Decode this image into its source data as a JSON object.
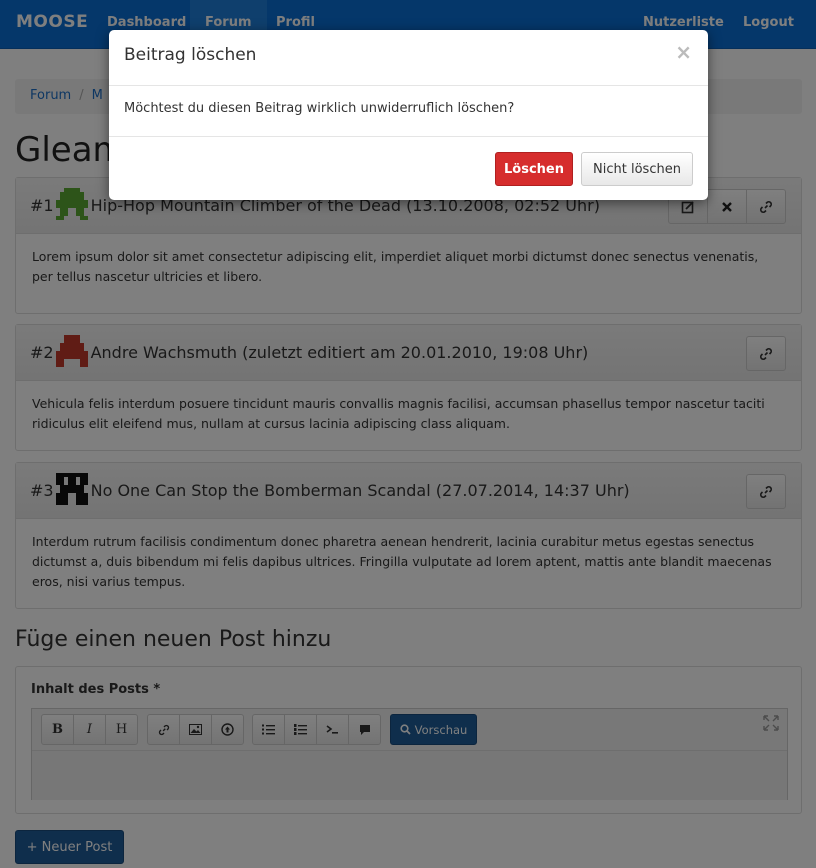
{
  "navbar": {
    "brand": "MOOSE",
    "links": [
      "Dashboard",
      "Forum",
      "Profil"
    ],
    "right_links": [
      "Nutzerliste",
      "Logout"
    ],
    "color": "#0b6ed4"
  },
  "breadcrumb": [
    "Forum",
    "M"
  ],
  "page_title": "Gleam",
  "posts": [
    {
      "number": "#1",
      "meta": "Hip-Hop Mountain Climber of the Dead (13.10.2008, 02:52 Uhr)",
      "body": "Lorem ipsum dolor sit amet consectetur adipiscing elit, imperdiet aliquet morbi dictumst donec senectus venenatis, per tellus nascetur ultricies et libero.",
      "avatar_color": "#5aa832",
      "actions": [
        "edit-icon",
        "delete-icon",
        "link-icon"
      ]
    },
    {
      "number": "#2",
      "meta": "Andre Wachsmuth (zuletzt editiert am 20.01.2010, 19:08 Uhr)",
      "body": "Vehicula felis interdum posuere tincidunt mauris convallis magnis facilisi, accumsan phasellus tempor nascetur taciti ridiculus elit eleifend mus, nullam at cursus lacinia adipiscing class aliquam.",
      "avatar_color": "#c0392b",
      "actions": [
        "link-icon"
      ]
    },
    {
      "number": "#3",
      "meta": "No One Can Stop the Bomberman Scandal (27.07.2014, 14:37 Uhr)",
      "body": "Interdum rutrum facilisis condimentum donec pharetra aenean hendrerit, lacinia curabitur metus egestas senectus dictumst a, duis bibendum mi felis dapibus ultrices. Fringilla vulputate ad lorem aptent, mattis ante blandit maecenas eros, nisi varius tempus.",
      "avatar_color": "#111111",
      "actions": [
        "link-icon"
      ]
    }
  ],
  "new_post": {
    "title": "Füge einen neuen Post hinzu",
    "label": "Inhalt des Posts *",
    "toolbar": {
      "format": [
        "B",
        "I",
        "H"
      ],
      "insert": [
        "link-icon",
        "image-icon",
        "upload-icon"
      ],
      "blocks": [
        "unordered-list-icon",
        "ordered-list-icon",
        "code-icon",
        "quote-icon"
      ],
      "preview": "Vorschau"
    },
    "submit": "+ Neuer Post"
  },
  "modal": {
    "title": "Beitrag löschen",
    "close": "×",
    "message": "Möchtest du diesen Beitrag wirklich unwiderruflich löschen?",
    "confirm": "Löschen",
    "cancel": "Nicht löschen",
    "confirm_color": "#d62d2d"
  }
}
